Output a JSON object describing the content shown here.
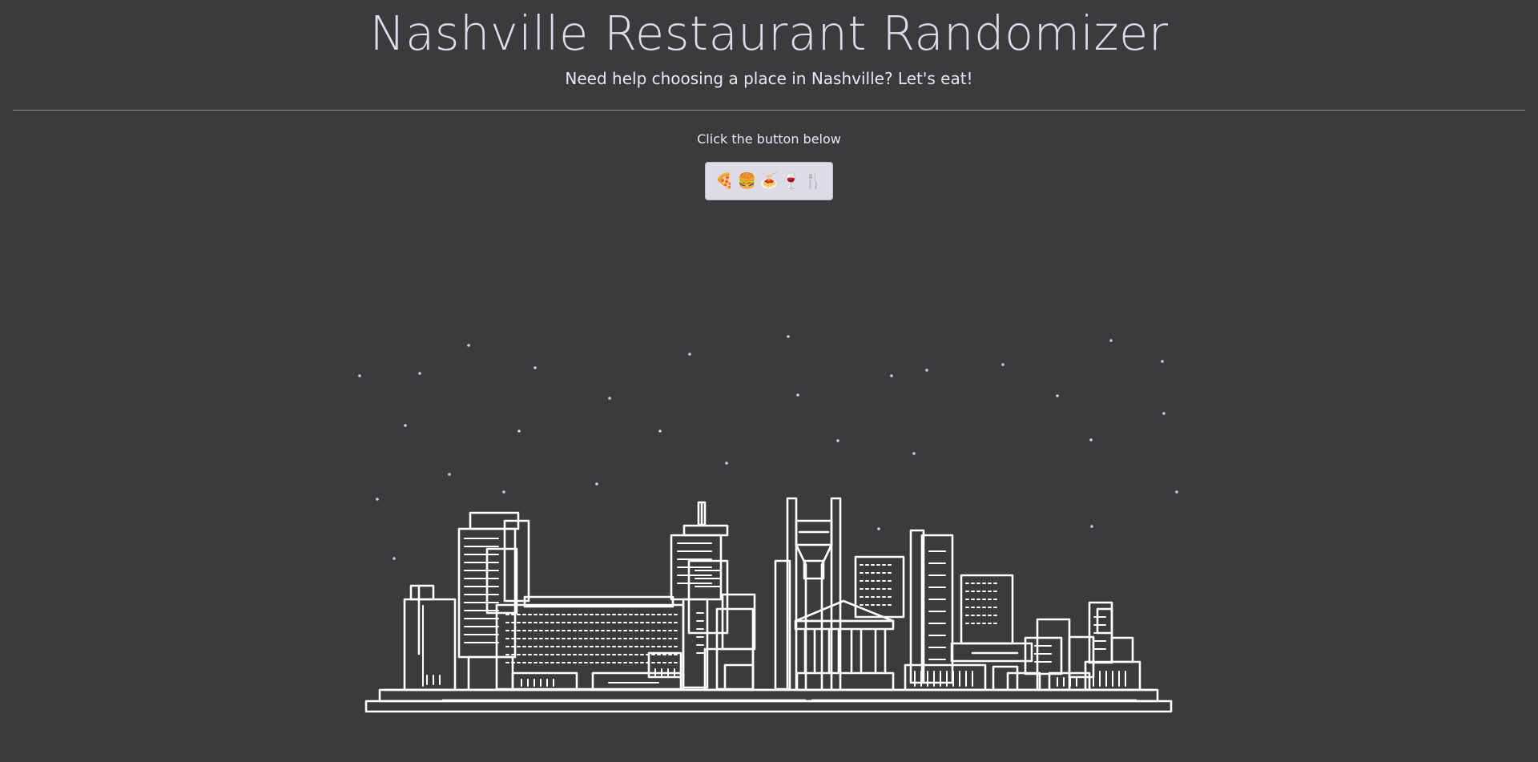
{
  "header": {
    "title": "Nashville Restaurant Randomizer",
    "subtitle": "Need help choosing a place in Nashville? Let's eat!"
  },
  "main": {
    "prompt": "Click the button below",
    "randomize_button": {
      "emojis": [
        "🍕",
        "🍔",
        "🍝",
        "🍷",
        "🍴"
      ]
    }
  },
  "illustration": {
    "subject": "nashville-skyline-night",
    "moon_color": "#d8d4cc",
    "line_color": "#ffffff"
  },
  "colors": {
    "background": "#3b3b3d",
    "button_bg": "#dcdce6"
  }
}
